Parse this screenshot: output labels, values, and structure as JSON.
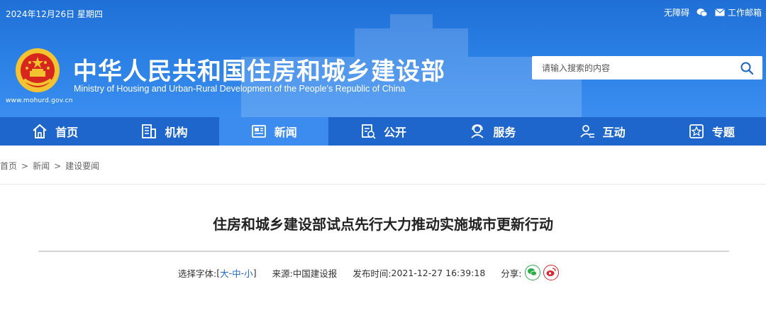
{
  "topbar": {
    "date": "2024年12月26日 星期四",
    "accessibility": "无障碍",
    "mailbox": "工作邮箱"
  },
  "header": {
    "site_url": "www.mohurd.gov.cn",
    "title_cn": "中华人民共和国住房和城乡建设部",
    "title_en": "Ministry of Housing and Urban-Rural Development of the People’s Republic of China",
    "search_placeholder": "请输入搜索的内容"
  },
  "nav": {
    "items": [
      {
        "label": "首页",
        "icon": "home-icon"
      },
      {
        "label": "机构",
        "icon": "building-icon"
      },
      {
        "label": "新闻",
        "icon": "news-icon"
      },
      {
        "label": "公开",
        "icon": "disclosure-icon"
      },
      {
        "label": "服务",
        "icon": "service-icon"
      },
      {
        "label": "互动",
        "icon": "interaction-icon"
      },
      {
        "label": "专题",
        "icon": "topic-icon"
      }
    ],
    "active_index": 2
  },
  "breadcrumb": {
    "items": [
      "首页",
      "新闻",
      "建设要闻"
    ],
    "separator": ">"
  },
  "article": {
    "title": "住房和城乡建设部试点先行大力推动实施城市更新行动",
    "font_size_label": "选择字体:",
    "font_sizes": [
      "大",
      "中",
      "小"
    ],
    "source_label": "来源:",
    "source": "中国建设报",
    "published_label": "发布时间:",
    "published": "2021-12-27 16:39:18",
    "share_label": "分享:"
  },
  "colors": {
    "brand_blue": "#1e66cc",
    "nav_active": "#3c8bee",
    "wechat_green": "#2aae45",
    "weibo_red": "#d9262f"
  }
}
